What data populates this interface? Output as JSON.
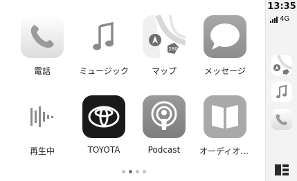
{
  "apps": [
    {
      "label": "電話",
      "icon": "phone-icon"
    },
    {
      "label": "ミュージック",
      "icon": "music-note-icon"
    },
    {
      "label": "マップ",
      "icon": "maps-icon"
    },
    {
      "label": "メッセージ",
      "icon": "message-bubble-icon"
    },
    {
      "label": "再生中",
      "icon": "now-playing-icon"
    },
    {
      "label": "TOYOTA",
      "icon": "toyota-logo-icon"
    },
    {
      "label": "Podcast",
      "icon": "podcast-icon"
    },
    {
      "label": "オーディオブ…",
      "icon": "audiobook-icon"
    }
  ],
  "pagination": {
    "count": 4,
    "active_index": 1
  },
  "status": {
    "time": "13:35",
    "network": "4G"
  },
  "sidebar": {
    "recent_apps": [
      "maps-icon",
      "music-note-icon",
      "phone-icon"
    ],
    "dashboard_icon": "dashboard-icon"
  },
  "colors": {
    "phone_green": "#4fd75e",
    "message_green": "#52d16a",
    "music_pink": "#f5456a",
    "podcast_purple": "#a44ad8",
    "audiobook_orange": "#f59a2c",
    "toyota_black": "#1a1a1a"
  }
}
